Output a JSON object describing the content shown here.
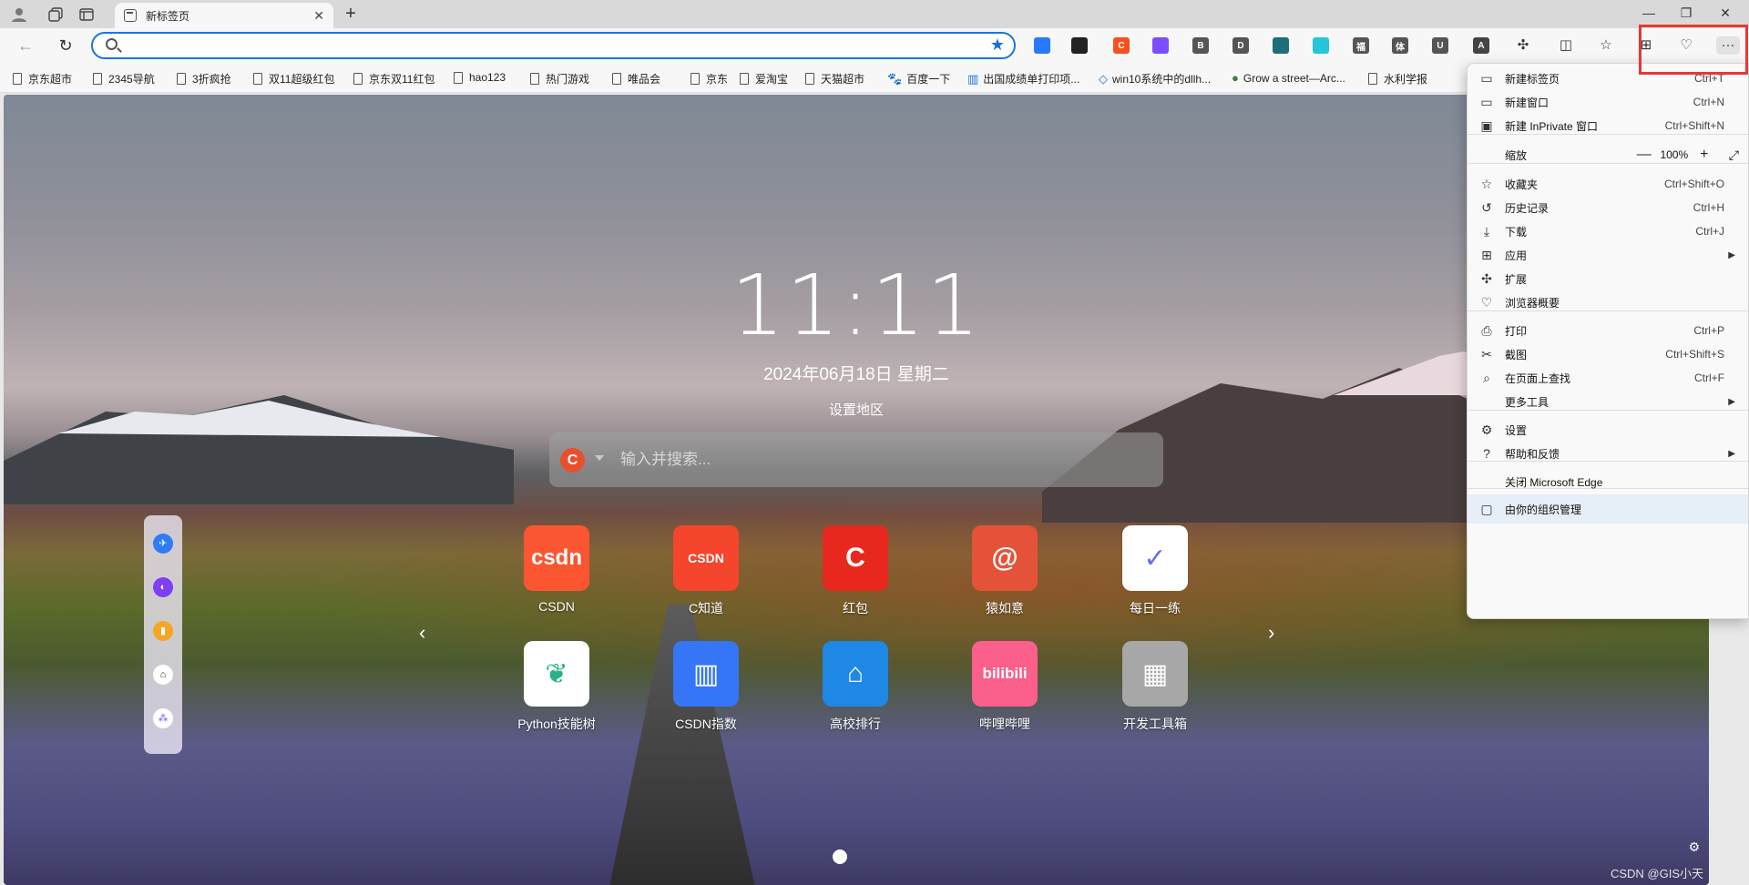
{
  "tab": {
    "title": "新标签页"
  },
  "search_bar": {
    "placeholder": "输入并搜索..."
  },
  "extensions": [
    {
      "name": "ext-1",
      "text": "",
      "color": "#2979ff"
    },
    {
      "name": "ext-2",
      "text": "",
      "color": "#222222"
    },
    {
      "name": "ext-c",
      "text": "C",
      "color": "#f4511e"
    },
    {
      "name": "ext-4",
      "text": "",
      "color": "#7c4dff"
    },
    {
      "name": "ext-b",
      "text": "B",
      "color": "#555555"
    },
    {
      "name": "ext-d",
      "text": "D",
      "color": "#555555"
    },
    {
      "name": "ext-7",
      "text": "",
      "color": "#1e6e7a"
    },
    {
      "name": "ext-8",
      "text": "",
      "color": "#26c6da"
    },
    {
      "name": "ext-fu",
      "text": "福",
      "color": "#555555"
    },
    {
      "name": "ext-ti",
      "text": "体",
      "color": "#555555"
    },
    {
      "name": "ext-u",
      "text": "U",
      "color": "#555555"
    },
    {
      "name": "ext-a",
      "text": "A",
      "color": "#444444"
    }
  ],
  "favorites": [
    {
      "label": "京东超市"
    },
    {
      "label": "2345导航"
    },
    {
      "label": "3折疯抢"
    },
    {
      "label": "双11超级红包"
    },
    {
      "label": "京东双11红包"
    },
    {
      "label": "hao123"
    },
    {
      "label": "热门游戏"
    },
    {
      "label": "唯品会"
    },
    {
      "label": "京东"
    },
    {
      "label": "爱淘宝"
    },
    {
      "label": "天猫超市"
    },
    {
      "label": "百度一下"
    },
    {
      "label": "出国成绩单打印项..."
    },
    {
      "label": "win10系统中的dllh..."
    },
    {
      "label": "Grow a street—Arc..."
    },
    {
      "label": "水利学报"
    }
  ],
  "clock": {
    "time": "11:11",
    "date": "2024年06月18日   星期二",
    "region": "设置地区"
  },
  "tiles": [
    {
      "label": "CSDN",
      "icon_text": "csdn",
      "color": "#fc5531"
    },
    {
      "label": "C知道",
      "icon_text": "CSDN",
      "color": "#f5452d"
    },
    {
      "label": "红包",
      "icon_text": "C",
      "color": "#e8281e"
    },
    {
      "label": "猿如意",
      "icon_text": "@",
      "color": "#e5523a"
    },
    {
      "label": "每日一练",
      "icon_text": "✓",
      "color": "#ffffff"
    },
    {
      "label": "Python技能树",
      "icon_text": "❦",
      "color": "#ffffff"
    },
    {
      "label": "CSDN指数",
      "icon_text": "▥",
      "color": "#3576f6"
    },
    {
      "label": "高校排行",
      "icon_text": "⌂",
      "color": "#1e88e5"
    },
    {
      "label": "哔哩哔哩",
      "icon_text": "bilibili",
      "color": "#fb5f8c"
    },
    {
      "label": "开发工具箱",
      "icon_text": "▦",
      "color": "#a7a7a7"
    }
  ],
  "menu": {
    "items": [
      {
        "label": "新建标签页",
        "shortcut": "Ctrl+T"
      },
      {
        "label": "新建窗口",
        "shortcut": "Ctrl+N"
      },
      {
        "label": "新建 InPrivate 窗口",
        "shortcut": "Ctrl+Shift+N"
      },
      {
        "label": "缩放",
        "shortcut": ""
      },
      {
        "label": "收藏夹",
        "shortcut": "Ctrl+Shift+O"
      },
      {
        "label": "历史记录",
        "shortcut": "Ctrl+H"
      },
      {
        "label": "下载",
        "shortcut": "Ctrl+J"
      },
      {
        "label": "应用",
        "shortcut": ""
      },
      {
        "label": "扩展",
        "shortcut": ""
      },
      {
        "label": "浏览器概要",
        "shortcut": ""
      },
      {
        "label": "打印",
        "shortcut": "Ctrl+P"
      },
      {
        "label": "截图",
        "shortcut": "Ctrl+Shift+S"
      },
      {
        "label": "在页面上查找",
        "shortcut": "Ctrl+F"
      },
      {
        "label": "更多工具",
        "shortcut": ""
      },
      {
        "label": "设置",
        "shortcut": ""
      },
      {
        "label": "帮助和反馈",
        "shortcut": ""
      },
      {
        "label": "关闭 Microsoft Edge",
        "shortcut": ""
      },
      {
        "label": "由你的组织管理",
        "shortcut": ""
      }
    ],
    "zoom_value": "100%",
    "zoom_minus": "—",
    "zoom_plus": "+"
  },
  "watermark": "CSDN @GIS小天"
}
